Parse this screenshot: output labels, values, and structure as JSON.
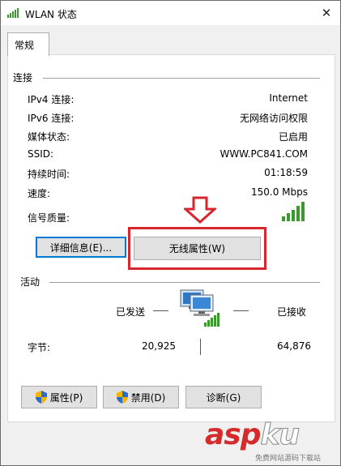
{
  "window": {
    "title": "WLAN 状态",
    "close_label": "✕"
  },
  "tab": {
    "label": "常规"
  },
  "connection": {
    "section_title": "连接",
    "rows": [
      {
        "label": "IPv4 连接:",
        "value": "Internet"
      },
      {
        "label": "IPv6 连接:",
        "value": "无网络访问权限"
      },
      {
        "label": "媒体状态:",
        "value": "已启用"
      },
      {
        "label": "SSID:",
        "value": "WWW.PC841.COM"
      },
      {
        "label": "持续时间:",
        "value": "01:18:59"
      },
      {
        "label": "速度:",
        "value": "150.0 Mbps"
      }
    ],
    "signal_label": "信号质量:",
    "signal_level": "5/5"
  },
  "buttons": {
    "details": "详细信息(E)...",
    "wireless_properties": "无线属性(W)",
    "properties": "属性(P)",
    "disable": "禁用(D)",
    "diagnose": "诊断(G)"
  },
  "activity": {
    "section_title": "活动",
    "sent_label": "已发送",
    "received_label": "已接收",
    "bytes_label": "字节:",
    "bytes_sent": "20,925",
    "bytes_received": "64,876"
  },
  "watermark": {
    "main_a": "asp",
    "main_b": "ku",
    "sub": "免费网站源码下载站"
  },
  "colors": {
    "highlight": "#d7262e",
    "signal": "#3a9a2e",
    "accent": "#0078d7"
  }
}
